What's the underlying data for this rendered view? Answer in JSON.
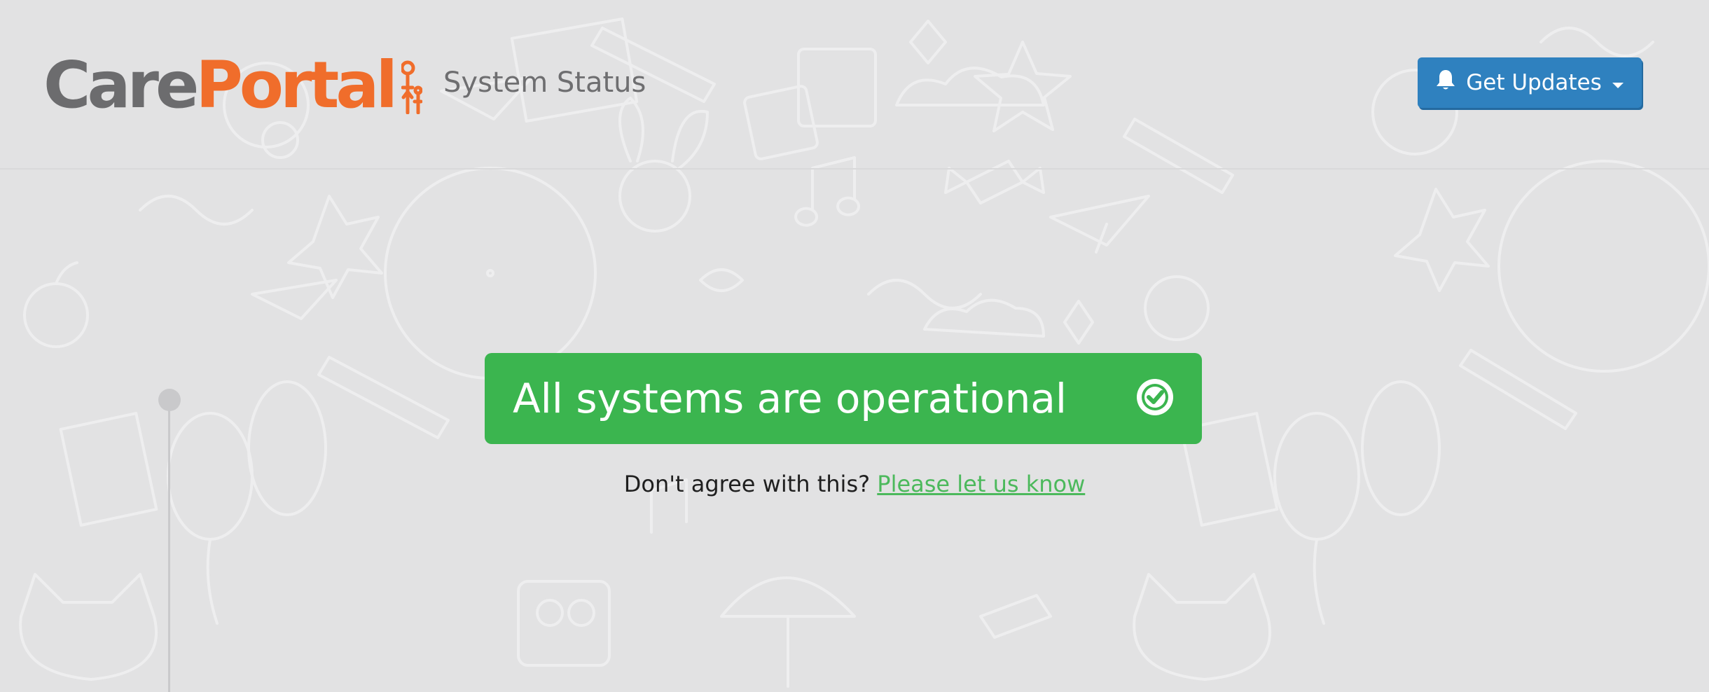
{
  "header": {
    "logo": {
      "text_a": "Care",
      "text_b": "Portal",
      "mark_icon": "carer-child-figures-icon"
    },
    "section_title": "System Status",
    "get_updates": {
      "label": "Get Updates",
      "icon": "bell-icon",
      "dropdown_icon": "caret-down-icon"
    }
  },
  "status": {
    "message": "All systems are operational",
    "icon": "check-circle-icon"
  },
  "feedback": {
    "prompt": "Don't agree with this?",
    "link_label": "Please let us know"
  },
  "colors": {
    "brand_gray": "#6c6c6e",
    "brand_orange": "#f06d2b",
    "button_blue": "#2f81bf",
    "operational_green": "#3bb54f",
    "link_green": "#4cb95c",
    "background": "#e2e2e3"
  }
}
